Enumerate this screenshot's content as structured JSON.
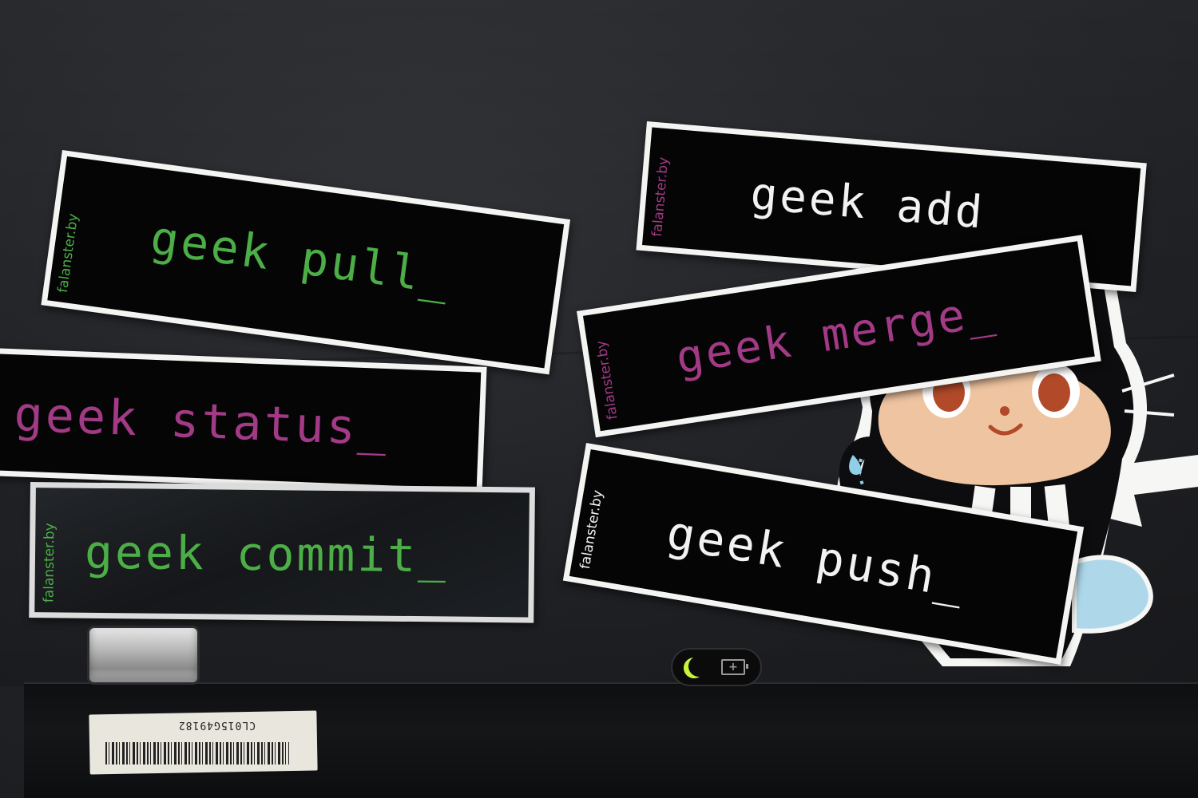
{
  "colors": {
    "green": "#4cae46",
    "magenta": "#a33a86",
    "white": "#f2f2f2",
    "indicator_green": "#c8f53c"
  },
  "stickers": [
    {
      "id": "pull",
      "brand": "falanster.by",
      "command": "geek pull_",
      "color": "green"
    },
    {
      "id": "add",
      "brand": "falanster.by",
      "command": "geek add",
      "color": "white"
    },
    {
      "id": "merge",
      "brand": "falanster.by",
      "command": "geek merge_",
      "color": "magenta"
    },
    {
      "id": "status",
      "brand": "",
      "command": "geek status_",
      "color": "magenta"
    },
    {
      "id": "commit",
      "brand": "falanster.by",
      "command": "geek commit_",
      "color": "green"
    },
    {
      "id": "push",
      "brand": "falanster.by",
      "command": "geek push_",
      "color": "white"
    }
  ],
  "laptop": {
    "serial_label": "CL015G49182",
    "icons": [
      "sleep-moon-icon",
      "battery-icon"
    ]
  }
}
